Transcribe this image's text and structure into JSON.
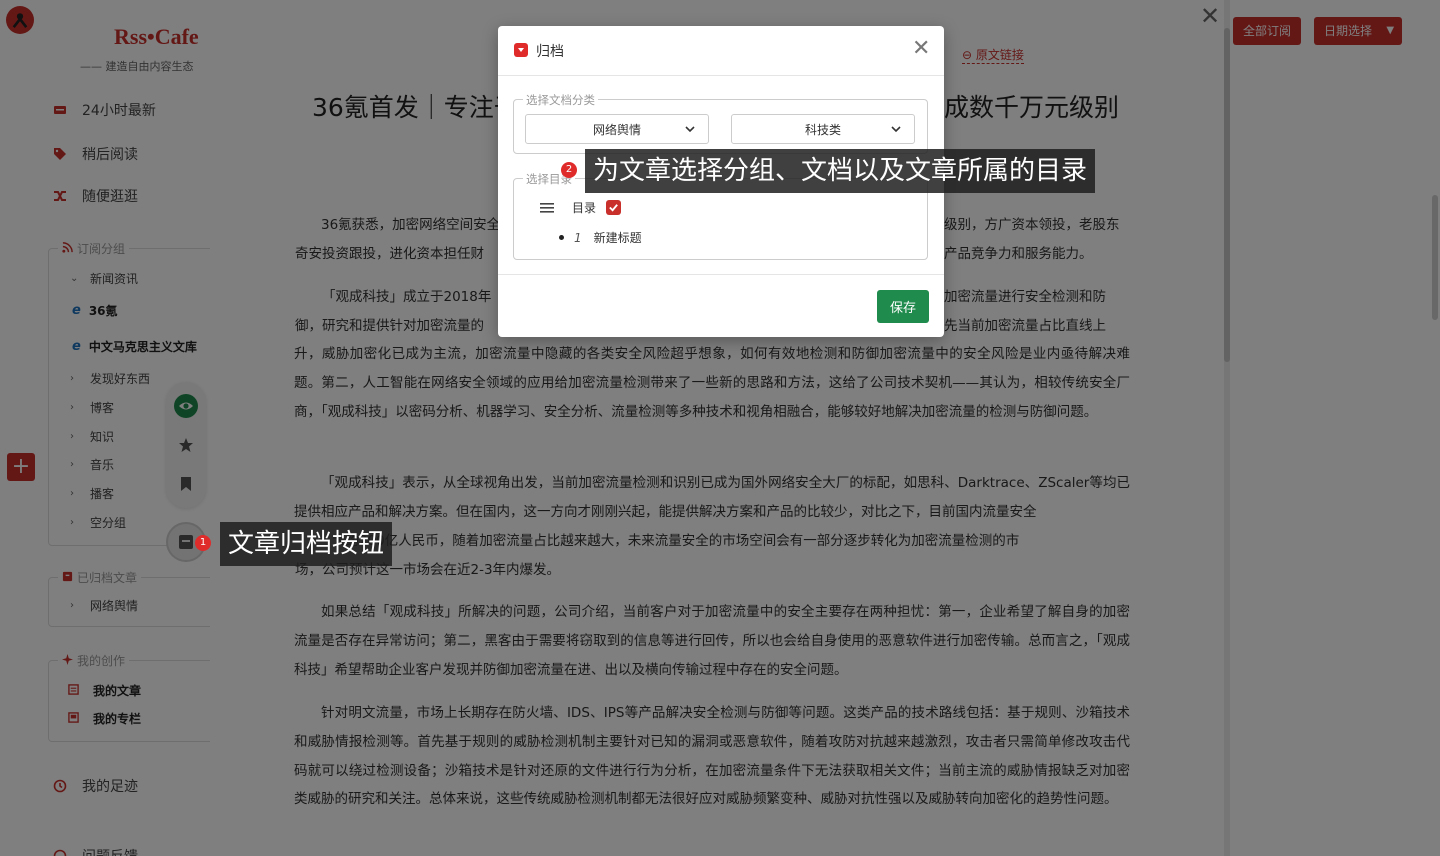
{
  "brand": {
    "name": "Rss•Cafe",
    "tagline": "—— 建造自由内容生态"
  },
  "nav": [
    {
      "label": "24小时最新"
    },
    {
      "label": "稍后阅读"
    },
    {
      "label": "随便逛逛"
    }
  ],
  "subscription_group": {
    "legend": "订阅分组",
    "items": [
      {
        "label": "新闻资讯",
        "expanded": true
      },
      {
        "label": "36氪",
        "feed": true
      },
      {
        "label": "中文马克思主义文库",
        "feed": true
      },
      {
        "label": "发现好东西"
      },
      {
        "label": "博客"
      },
      {
        "label": "知识"
      },
      {
        "label": "音乐"
      },
      {
        "label": "播客"
      },
      {
        "label": "空分组"
      }
    ]
  },
  "archived_group": {
    "legend": "已归档文章",
    "items": [
      {
        "label": "网络舆情"
      }
    ]
  },
  "creation_group": {
    "legend": "我的创作",
    "items": [
      {
        "label": "我的文章"
      },
      {
        "label": "我的专栏"
      }
    ]
  },
  "footer_nav": [
    {
      "label": "我的足迹"
    },
    {
      "label": "问题反馈"
    }
  ],
  "header_buttons": {
    "all_subscriptions": "全部订阅",
    "date_select": "日期选择"
  },
  "article": {
    "original_link": "原文链接",
    "title_left": "36氪首发｜专注于",
    "title_right": "成数千万元级别",
    "paragraphs": [
      "36氪获悉，加密网络空间安全",
      "奇安投资跟投，进化资本担任财",
      "「观成科技」成立于2018年",
      "御，研究和提供针对加密流量的",
      "升，威胁加密化已成为主流，加密流量中隐藏的各类安全风险超乎想象，如何有效地检测和防御加密流量中的安全风险是业内亟待解决难题。第二，人工智能在网络安全领域的应用给加密流量检测带来了一些新的思路和方法，这给了公司技术契机——其认为，相较传统安全厂商，「观成科技」以密码分析、机器学习、安全分析、流量检测等多种技术和视角相融合，能够较好地解决加密流量的检测与防御问题。",
      "「观成科技」表示，从全球视角出发，当前加密流量检测和识别已成为国外网络安全大厂的标配，如思科、Darktrace、ZScaler等均已提供相应产品和解决方案。但在国内，这一方向才刚刚兴起，能提供解决方案和产品的比较少，对比之下，目前国内流量安全",
      "大约200亿人民币，随着加密流量占比越来越大，未来流量安全的市场空间会有一部分逐步转化为加密流量检测的市",
      "场，公司预计这一市场会在近2-3年内爆发。",
      "如果总结「观成科技」所解决的问题，公司介绍，当前客户对于加密流量中的安全主要存在两种担忧：第一，企业希望了解自身的加密流量是否存在异常访问；第二，黑客由于需要将窃取到的信息等进行回传，所以也会给自身使用的恶意软件进行加密传输。总而言之，「观成科技」希望帮助企业客户发现并防御加密流量在进、出以及横向传输过程中存在的安全问题。",
      "针对明文流量，市场上长期存在防火墙、IDS、IPS等产品解决安全检测与防御等问题。这类产品的技术路线包括：基于规则、沙箱技术和威胁情报检测等。首先基于规则的威胁检测机制主要针对已知的漏洞或恶意软件，随着攻防对抗越来越激烈，攻击者只需简单修改攻击代码就可以绕过检测设备；沙箱技术是针对还原的文件进行行为分析，在加密流量条件下无法获取相关文件；当前主流的威胁情报缺乏对加密类威胁的研究和关注。总体来说，这些传统威胁检测机制都无法很好应对威胁频繁变种、威胁对抗性强以及威胁转向加密化的趋势性问题。"
    ],
    "para_right_fragments": [
      "级别，方广资本领投，老股东",
      "产品竞争力和服务能力。",
      "加密流量进行安全检测和防",
      "先当前加密流量占比直线上"
    ]
  },
  "modal": {
    "title": "归档",
    "category_legend": "选择文档分类",
    "select_group": "网络舆情",
    "select_doc": "科技类",
    "directory_legend": "选择目录",
    "directory_root": "目录",
    "sub_number": "1",
    "sub_title": "新建标题",
    "save": "保存"
  },
  "callouts": [
    {
      "badge": "1",
      "text": "文章归档按钮"
    },
    {
      "badge": "2",
      "text": "为文章选择分组、文档以及文章所属的目录"
    }
  ],
  "colors": {
    "brand_red": "#c9302c",
    "save_green": "#1f8b4c",
    "badge_red": "#e02b2b"
  }
}
